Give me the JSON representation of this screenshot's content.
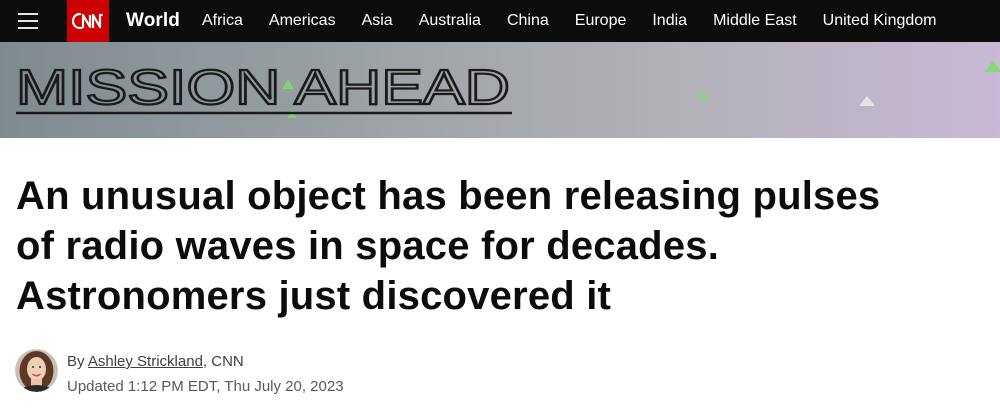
{
  "header": {
    "logo_text": "CNN",
    "section": "World",
    "nav": [
      "Africa",
      "Americas",
      "Asia",
      "Australia",
      "China",
      "Europe",
      "India",
      "Middle East",
      "United Kingdom"
    ]
  },
  "banner": {
    "title": "MISSION AHEAD"
  },
  "article": {
    "headline_lines": [
      "An unusual object has been releasing pulses",
      "of radio waves in space for decades.",
      "Astronomers just discovered it"
    ],
    "byline_prefix": "By",
    "author": "Ashley Strickland",
    "byline_suffix": ", CNN",
    "updated": "Updated 1:12 PM EDT, Thu July 20, 2023"
  },
  "colors": {
    "brand_red": "#cc0000",
    "nav_bg": "#0c0c0c"
  },
  "icons": [
    "menu-icon",
    "cnn-logo",
    "author-avatar"
  ]
}
